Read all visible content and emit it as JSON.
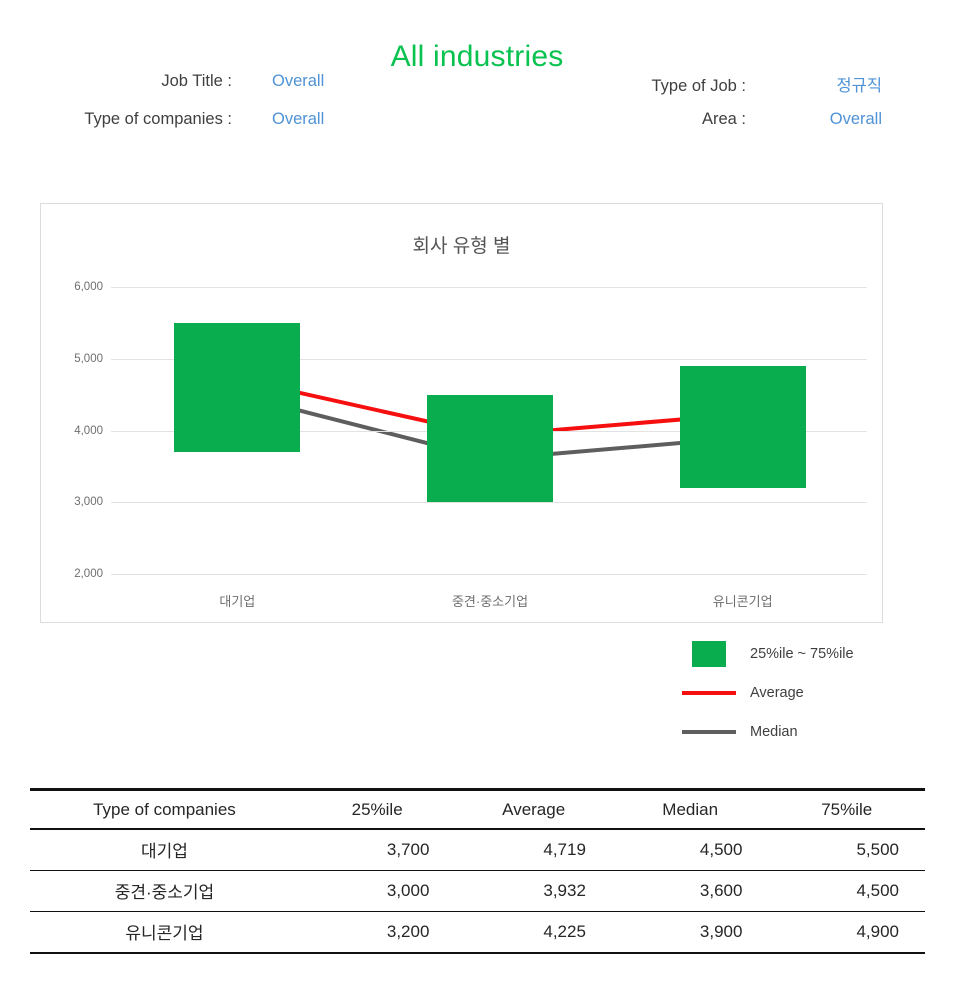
{
  "page": {
    "title": "All industries",
    "title_color": "#0ac24f"
  },
  "filters": [
    {
      "label": "Job Title :",
      "value": "Overall"
    },
    {
      "label": "Type of Job :",
      "value": "정규직"
    },
    {
      "label": "Type of companies :",
      "value": "Overall"
    },
    {
      "label": "Area :",
      "value": "Overall"
    }
  ],
  "legend": {
    "items": [
      {
        "key": "swatch-green",
        "label": "25%ile ~ 75%ile",
        "color": "#0aad4e"
      },
      {
        "key": "line-red",
        "label": "Average",
        "color": "#f60f0f"
      },
      {
        "key": "line-gray",
        "label": "Median",
        "color": "#5e5e5e"
      }
    ]
  },
  "table": {
    "headers": [
      "Type of companies",
      "25%ile",
      "Average",
      "Median",
      "75%ile"
    ],
    "rows": [
      {
        "name": "대기업",
        "p25": "3,700",
        "avg": "4,719",
        "median": "4,500",
        "p75": "5,500"
      },
      {
        "name": "중견·중소기업",
        "p25": "3,000",
        "avg": "3,932",
        "median": "3,600",
        "p75": "4,500"
      },
      {
        "name": "유니콘기업",
        "p25": "3,200",
        "avg": "4,225",
        "median": "3,900",
        "p75": "4,900"
      }
    ]
  },
  "chart_data": {
    "type": "bar",
    "title": "회사 유형 별",
    "xlabel": "",
    "ylabel": "",
    "categories": [
      "대기업",
      "중견·중소기업",
      "유니콘기업"
    ],
    "ylim": [
      2000,
      6000
    ],
    "yticks": [
      6000,
      5000,
      4000,
      3000,
      2000
    ],
    "ytick_labels": [
      "6,000",
      "5,000",
      "4,000",
      "3,000",
      "2,000"
    ],
    "grid": true,
    "legend_position": "below-right",
    "series": [
      {
        "name": "25%ile ~ 75%ile",
        "type": "range-bar",
        "color": "#0aad4e",
        "low": [
          3700,
          3000,
          3200
        ],
        "high": [
          5500,
          4500,
          4900
        ]
      },
      {
        "name": "Average",
        "type": "line",
        "color": "#f60f0f",
        "marker_color": "#d8d8d8",
        "values": [
          4719,
          3932,
          4225
        ]
      },
      {
        "name": "Median",
        "type": "line",
        "color": "#5e5e5e",
        "marker_color": "#f5a60a",
        "values": [
          4500,
          3600,
          3900
        ]
      }
    ]
  }
}
